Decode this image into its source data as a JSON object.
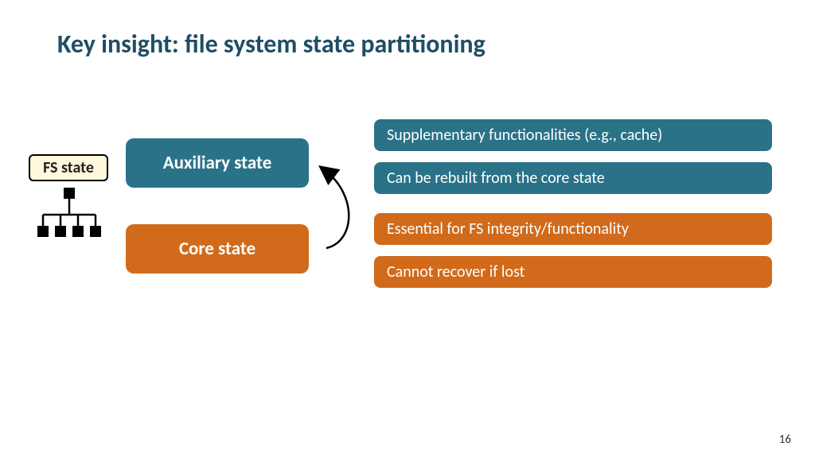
{
  "title": "Key insight: file system state partitioning",
  "fs_label": "FS state",
  "states": {
    "auxiliary": {
      "label": "Auxiliary state"
    },
    "core": {
      "label": "Core state"
    }
  },
  "bars": {
    "aux1": "Supplementary functionalities (e.g., cache)",
    "aux2": "Can be rebuilt from the core state",
    "core1": "Essential for FS integrity/functionality",
    "core2": "Cannot recover if lost"
  },
  "page_number": "16",
  "colors": {
    "teal": "#2a7288",
    "orange": "#d16a1a",
    "title": "#1f4e66"
  }
}
